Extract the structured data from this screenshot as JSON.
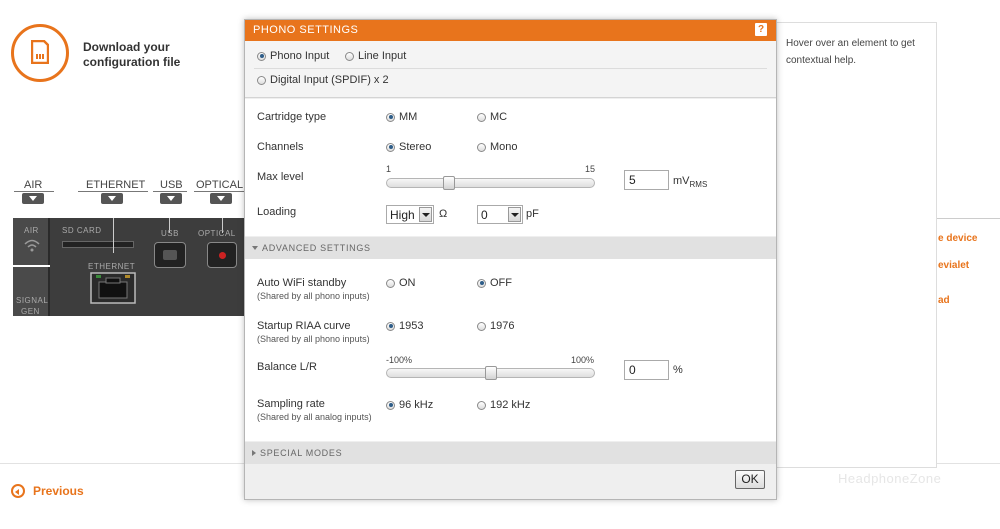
{
  "background": {
    "download": {
      "line1": "Download your",
      "line2": "configuration file"
    },
    "ports": [
      "AIR",
      "ETHERNET",
      "USB",
      "OPTICAL"
    ],
    "device": {
      "air": "AIR",
      "sd_card": "SD CARD",
      "ethernet": "ETHERNET",
      "usb": "USB",
      "optical": "OPTICAL",
      "signal_gen_1": "SIGNAL",
      "signal_gen_2": "GEN"
    },
    "previous": "Previous",
    "side_links": [
      "e device",
      "evialet",
      "ad"
    ],
    "watermark": "HeadphoneZone"
  },
  "help_panel": {
    "text": "Hover over an element to get contextual help."
  },
  "modal": {
    "title": "PHONO SETTINGS",
    "help_button": "?",
    "inputs": {
      "phono": "Phono Input",
      "line": "Line Input",
      "digital": "Digital Input (SPDIF) x 2",
      "selected": "Phono Input"
    },
    "settings": {
      "cartridge": {
        "label": "Cartridge type",
        "opt1": "MM",
        "opt2": "MC",
        "selected": "MM"
      },
      "channels": {
        "label": "Channels",
        "opt1": "Stereo",
        "opt2": "Mono",
        "selected": "Stereo"
      },
      "max_level": {
        "label": "Max level",
        "min": "1",
        "max": "15",
        "value": "5",
        "unit": "mV",
        "unit_sub": "RMS",
        "fraction": 0.286
      },
      "loading": {
        "label": "Loading",
        "resistance": "High",
        "resistance_unit": "Ω",
        "capacitance": "0",
        "capacitance_unit": "pF"
      }
    },
    "advanced_label": "ADVANCED SETTINGS",
    "advanced": {
      "wifi": {
        "label": "Auto WiFi standby",
        "sub": "(Shared by all phono inputs)",
        "opt1": "ON",
        "opt2": "OFF",
        "selected": "OFF"
      },
      "riaa": {
        "label": "Startup RIAA curve",
        "sub": "(Shared by all phono inputs)",
        "opt1": "1953",
        "opt2": "1976",
        "selected": "1953"
      },
      "balance": {
        "label": "Balance L/R",
        "min": "-100%",
        "max": "100%",
        "value": "0",
        "unit": "%",
        "fraction": 0.5
      },
      "sampling": {
        "label": "Sampling rate",
        "sub": "(Shared by all analog inputs)",
        "opt1": "96 kHz",
        "opt2": "192 kHz",
        "selected": "96 kHz"
      }
    },
    "special_label": "SPECIAL MODES",
    "ok": "OK"
  },
  "colors": {
    "accent": "#e8741c",
    "radio_selected": "#2e5d88"
  }
}
